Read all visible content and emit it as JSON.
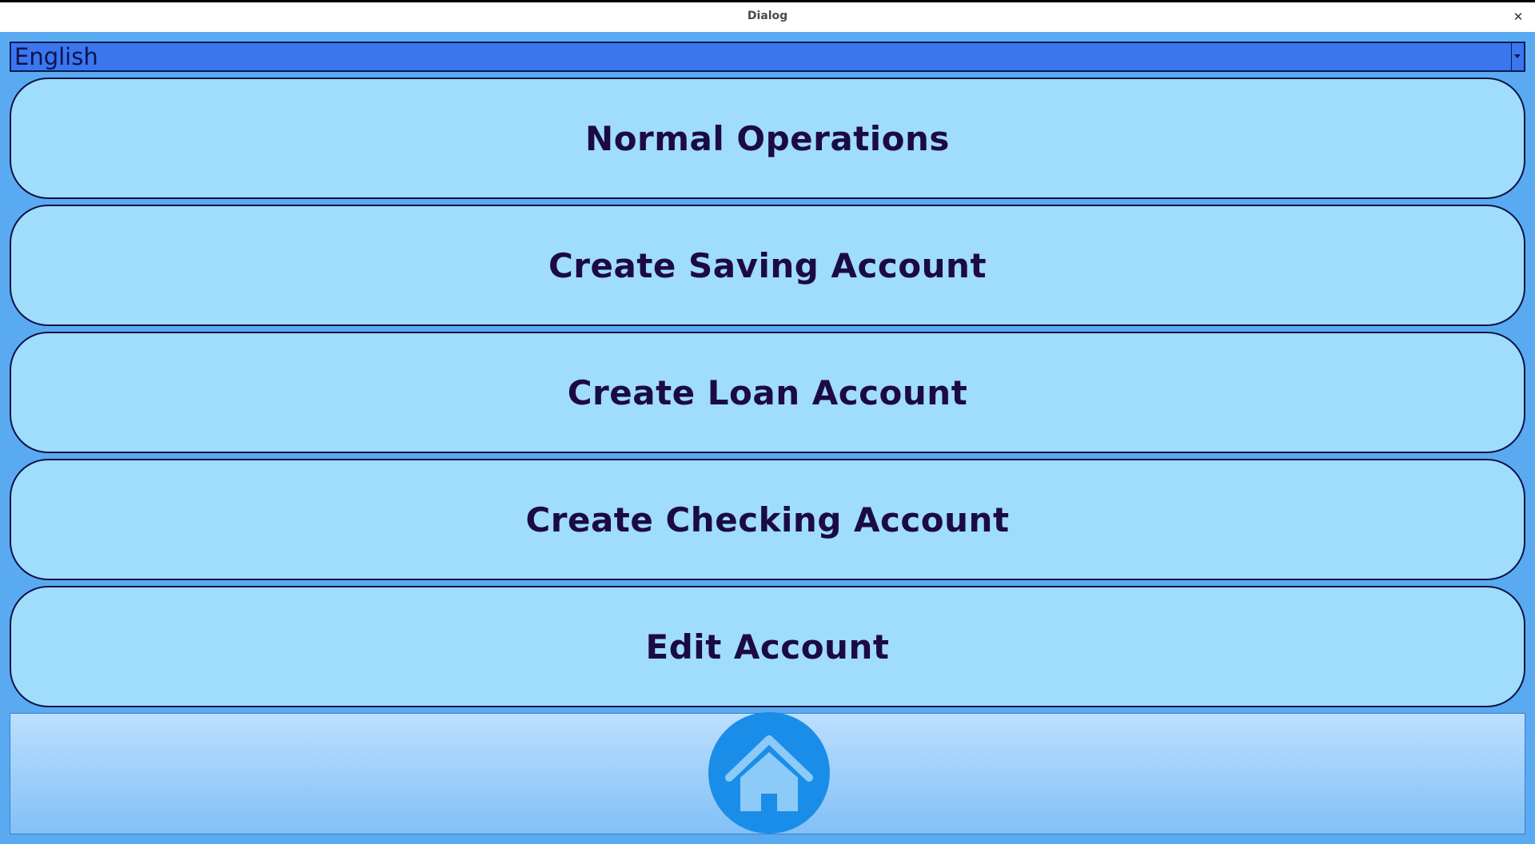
{
  "window": {
    "title": "Dialog",
    "close_icon": "close-icon",
    "close_glyph": "✕"
  },
  "language_select": {
    "selected": "English",
    "arrow_icon": "chevron-down-icon"
  },
  "menu": {
    "items": [
      {
        "label": "Normal Operations"
      },
      {
        "label": "Create Saving Account"
      },
      {
        "label": "Create Loan Account"
      },
      {
        "label": "Create Checking Account"
      },
      {
        "label": "Edit Account"
      }
    ]
  },
  "footer": {
    "home_icon": "home-icon"
  },
  "colors": {
    "background": "#5aaaf2",
    "button_fill": "#a0dcfc",
    "button_text": "#1b0a45",
    "select_fill": "#3a76ee",
    "home_circle": "#1a8de8",
    "home_glyph": "#8ccaf8"
  }
}
